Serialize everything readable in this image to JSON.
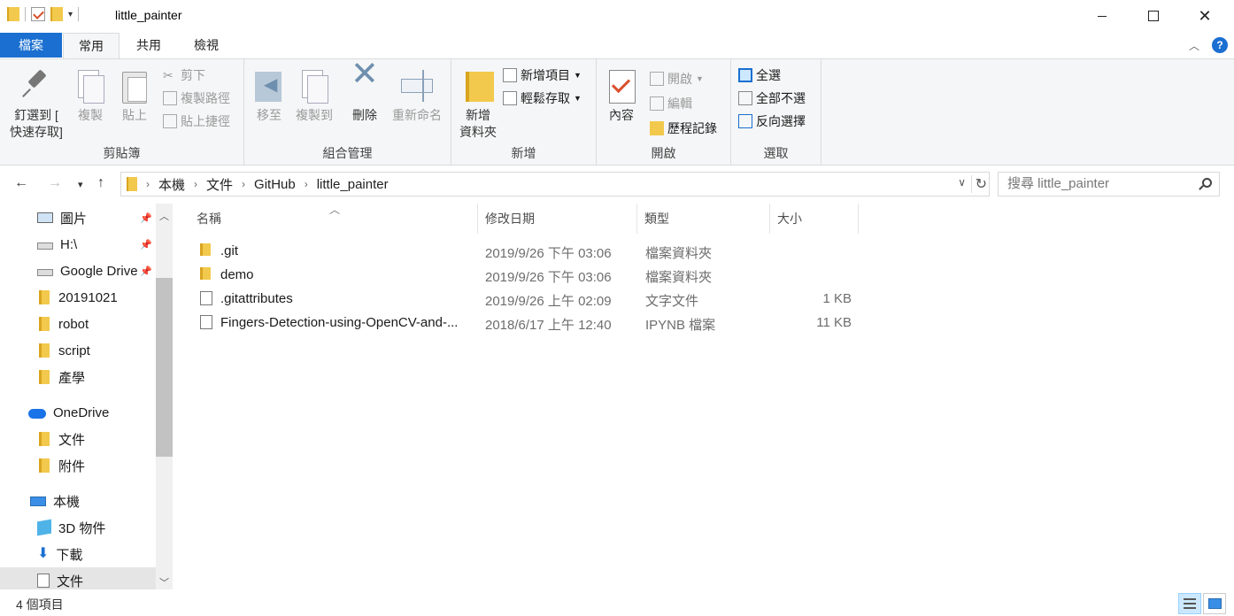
{
  "window": {
    "title": "little_painter"
  },
  "tabs": {
    "file": "檔案",
    "home": "常用",
    "share": "共用",
    "view": "檢視"
  },
  "ribbon": {
    "clipboard": {
      "label": "剪貼簿",
      "pin_line1": "釘選到 [",
      "pin_line2": "快速存取]",
      "copy": "複製",
      "paste": "貼上",
      "cut": "剪下",
      "copy_path": "複製路徑",
      "paste_shortcut": "貼上捷徑"
    },
    "organize": {
      "label": "組合管理",
      "move_to": "移至",
      "copy_to": "複製到",
      "delete": "刪除",
      "rename": "重新命名"
    },
    "new": {
      "label": "新增",
      "new_folder_line1": "新增",
      "new_folder_line2": "資料夾",
      "new_item": "新增項目",
      "easy_access": "輕鬆存取"
    },
    "open": {
      "label": "開啟",
      "properties": "內容",
      "open": "開啟",
      "edit": "編輯",
      "history": "歷程記錄"
    },
    "select": {
      "label": "選取",
      "select_all": "全選",
      "select_none": "全部不選",
      "invert": "反向選擇"
    }
  },
  "address": {
    "crumbs": [
      "本機",
      "文件",
      "GitHub",
      "little_painter"
    ],
    "search_placeholder": "搜尋 little_painter"
  },
  "navpane": {
    "items": [
      {
        "label": "圖片",
        "pinned": true
      },
      {
        "label": "H:\\",
        "pinned": true
      },
      {
        "label": "Google Drive",
        "pinned": true
      },
      {
        "label": "20191021"
      },
      {
        "label": "robot"
      },
      {
        "label": "script"
      },
      {
        "label": "產學"
      },
      {
        "label": "OneDrive"
      },
      {
        "label": "文件"
      },
      {
        "label": "附件"
      },
      {
        "label": "本機"
      },
      {
        "label": "3D 物件"
      },
      {
        "label": "下載"
      },
      {
        "label": "文件"
      }
    ]
  },
  "filelist": {
    "columns": {
      "name": "名稱",
      "date": "修改日期",
      "type": "類型",
      "size": "大小"
    },
    "rows": [
      {
        "name": ".git",
        "date": "2019/9/26 下午 03:06",
        "type": "檔案資料夾",
        "size": ""
      },
      {
        "name": "demo",
        "date": "2019/9/26 下午 03:06",
        "type": "檔案資料夾",
        "size": ""
      },
      {
        "name": ".gitattributes",
        "date": "2019/9/26 上午 02:09",
        "type": "文字文件",
        "size": "1 KB"
      },
      {
        "name": "Fingers-Detection-using-OpenCV-and-...",
        "date": "2018/6/17 上午 12:40",
        "type": "IPYNB 檔案",
        "size": "11 KB"
      }
    ]
  },
  "status": {
    "count": "4 個項目"
  }
}
